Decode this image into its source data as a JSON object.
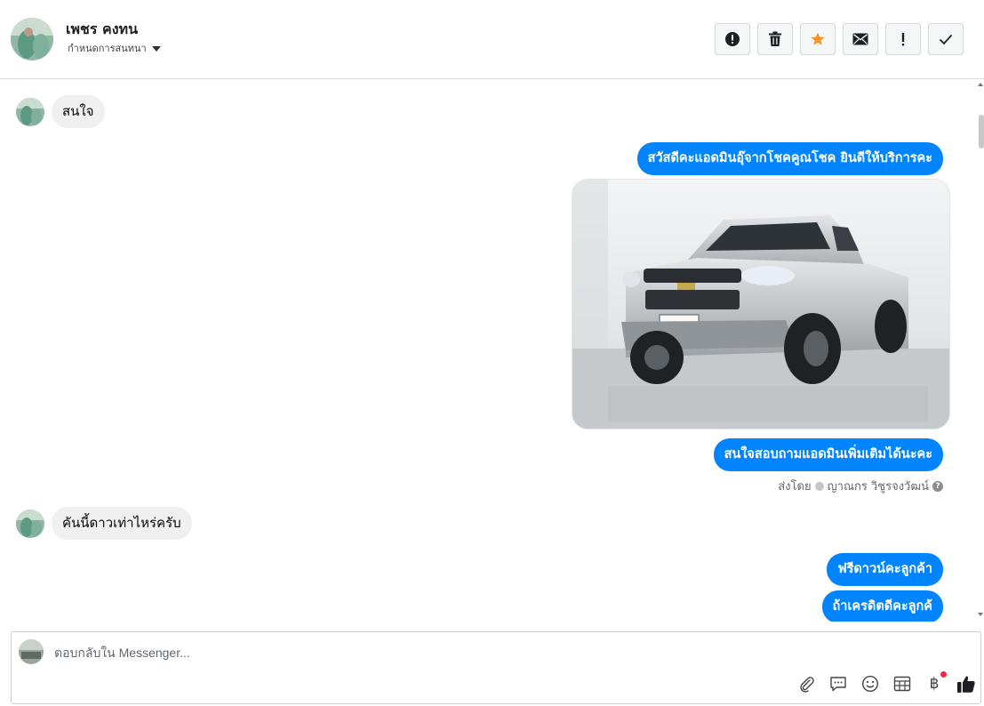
{
  "header": {
    "contact_name": "เพชร คงทน",
    "stage_label": "กำหนดการสนทนา",
    "actions": [
      {
        "name": "report-spam-button",
        "icon": "alert-circle-icon"
      },
      {
        "name": "delete-button",
        "icon": "trash-icon"
      },
      {
        "name": "star-button",
        "icon": "star-icon",
        "color": "#f5962a"
      },
      {
        "name": "mark-unread-button",
        "icon": "envelope-icon"
      },
      {
        "name": "mark-important-button",
        "icon": "exclamation-icon"
      },
      {
        "name": "mark-done-button",
        "icon": "check-icon"
      }
    ]
  },
  "messages": [
    {
      "direction": "in",
      "text": "สนใจ"
    },
    {
      "direction": "out",
      "text": "สวัสดีคะแอดมินอุ๊จากโชคคูณโชค ยินดีให้บริการคะ"
    },
    {
      "direction": "out",
      "type": "image",
      "alt": "silver pickup truck photo"
    },
    {
      "direction": "out",
      "text": "สนใจสอบถามแอดมินเพิ่มเติมได้นะคะ"
    },
    {
      "direction": "in",
      "text": "คันนี้ดาวเท่าไหร่ครับ"
    },
    {
      "direction": "out",
      "text": "ฟรีดาวน์คะลูกค้า"
    },
    {
      "direction": "out",
      "text": "ถ้าเครดิตดีคะลูกค้"
    }
  ],
  "sent_by": {
    "prefix": "ส่งโดย",
    "agent": "ญาณกร วิชูรจงวัฒน์"
  },
  "composer": {
    "placeholder": "ตอบกลับใน Messenger...",
    "tools": [
      "paperclip-icon",
      "saved-reply-icon",
      "emoji-icon",
      "table-icon",
      "baht-icon",
      "thumbs-up-icon"
    ],
    "baht_symbol": "฿"
  },
  "colors": {
    "outgoing_bubble": "#0084ff",
    "incoming_bubble": "#f0f0f0",
    "accent_star": "#f5962a",
    "notification_dot": "#f02849"
  }
}
